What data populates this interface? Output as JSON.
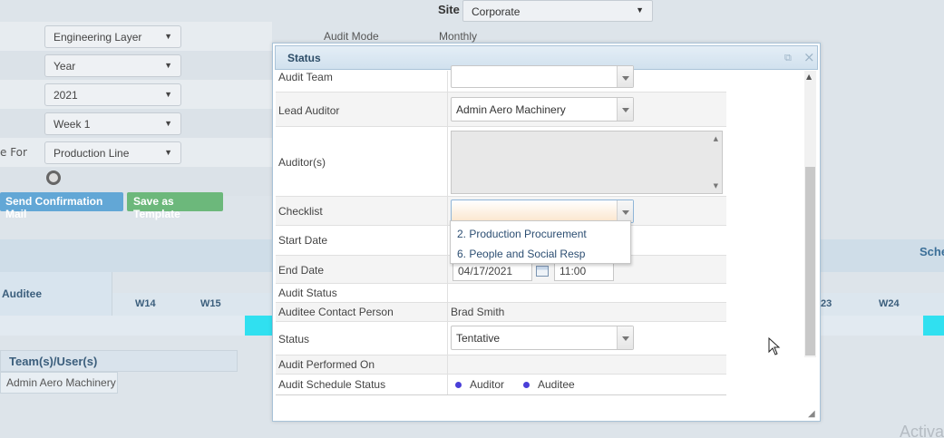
{
  "background": {
    "site": {
      "label": "Site",
      "value": "Corporate"
    },
    "audit_mode": {
      "label": "Audit Mode",
      "value": "Monthly"
    },
    "selects": [
      "Engineering Layer",
      "Year",
      "2021",
      "Week 1",
      "Production Line"
    ],
    "schedule_for_label": "e For",
    "buttons": {
      "send_mail": "Send Confirmation Mail",
      "save_template": "Save as Template"
    },
    "schedule_header_partial": "Sche",
    "auditee_header": "Auditee",
    "weeks": [
      "W14",
      "W15",
      "23",
      "W24"
    ],
    "team_header": "Team(s)/User(s)",
    "team_row": "Admin Aero Machinery",
    "watermark": "Activa"
  },
  "dialog": {
    "title": "Status",
    "rows": {
      "audit_team": {
        "label": "Audit Team",
        "value": ""
      },
      "lead_auditor": {
        "label": "Lead Auditor",
        "value": "Admin Aero Machinery"
      },
      "auditors": {
        "label": "Auditor(s)"
      },
      "checklist": {
        "label": "Checklist",
        "value": ""
      },
      "start_date": {
        "label": "Start Date"
      },
      "end_date": {
        "label": "End Date",
        "date": "04/17/2021",
        "time": "11:00"
      },
      "audit_status": {
        "label": "Audit Status",
        "value": ""
      },
      "auditee_contact": {
        "label": "Auditee Contact Person",
        "value": "Brad Smith"
      },
      "status": {
        "label": "Status",
        "value": "Tentative"
      },
      "audit_performed_on": {
        "label": "Audit Performed On",
        "value": ""
      },
      "audit_schedule_status": {
        "label": "Audit Schedule Status",
        "legend": [
          "Auditor",
          "Auditee"
        ]
      }
    },
    "checklist_options": [
      "2. Production Procurement",
      "6. People and Social Resp"
    ]
  },
  "colors": {
    "legend_dot": "#4a3fd8",
    "accent_blue": "#62a7d6",
    "accent_green": "#6cb87b",
    "schedule_cyan": "#30e0f0"
  }
}
